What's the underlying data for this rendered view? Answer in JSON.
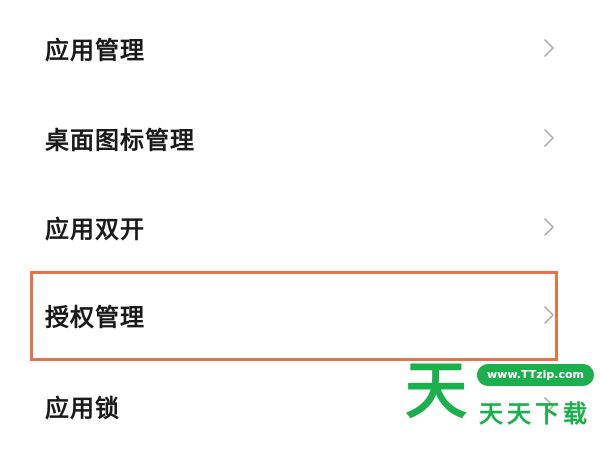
{
  "menu": {
    "items": [
      {
        "label": "应用管理"
      },
      {
        "label": "桌面图标管理"
      },
      {
        "label": "应用双开"
      },
      {
        "label": "授权管理"
      },
      {
        "label": "应用锁"
      }
    ],
    "highlighted_item": "授权管理",
    "highlight_color": "#e7734a",
    "chevron_icon": "chevron-right-icon"
  },
  "watermark": {
    "big_char": "天",
    "url": "www.TTzip.com",
    "text": "天天下载",
    "color": "#1bb04d"
  }
}
